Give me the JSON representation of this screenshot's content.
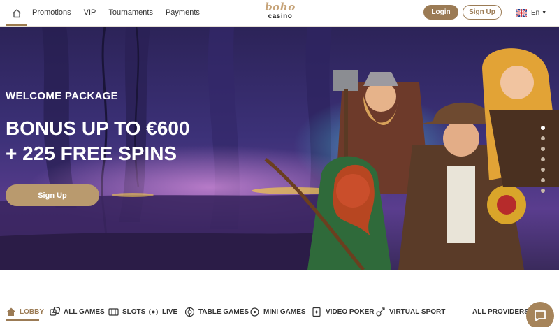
{
  "header": {
    "nav": [
      "Promotions",
      "VIP",
      "Tournaments",
      "Payments"
    ],
    "logo_top": "boho",
    "logo_bottom": "casino",
    "login_label": "Login",
    "signup_label": "Sign Up",
    "language": "En"
  },
  "hero": {
    "eyebrow": "WELCOME PACKAGE",
    "title_line1": "BONUS UP TO €600",
    "title_line2": "+ 225 FREE SPINS",
    "cta_label": "Sign Up",
    "slides_total": 7,
    "active_slide": 1
  },
  "categories": {
    "items": [
      {
        "label": "LOBBY",
        "icon": "home-icon"
      },
      {
        "label": "ALL GAMES",
        "icon": "dice-icon"
      },
      {
        "label": "SLOTS",
        "icon": "slot-machine-icon"
      },
      {
        "label": "LIVE",
        "icon": "live-icon"
      },
      {
        "label": "TABLE GAMES",
        "icon": "roulette-icon"
      },
      {
        "label": "MINI GAMES",
        "icon": "mini-games-icon"
      },
      {
        "label": "VIDEO POKER",
        "icon": "cards-icon"
      },
      {
        "label": "VIRTUAL SPORT",
        "icon": "virtual-sport-icon"
      }
    ],
    "active": "LOBBY",
    "providers_label": "ALL PROVIDERS"
  },
  "colors": {
    "accent": "#9b7b55",
    "cta": "#b99a6e",
    "hero_bg_top": "#3a2a6b",
    "hero_bg_bottom": "#5a3a8c"
  }
}
